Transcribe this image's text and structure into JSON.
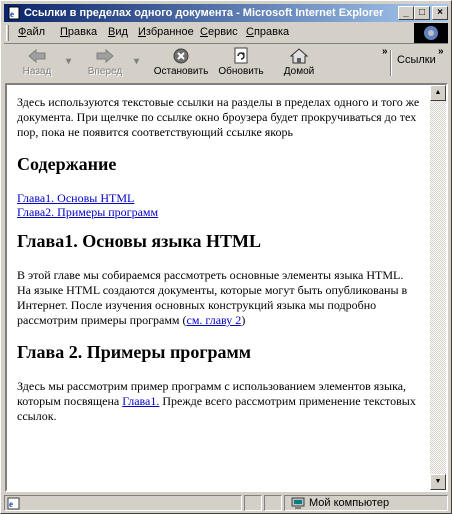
{
  "window": {
    "title": "Ссылки в пределах одного документа - Microsoft Internet Explorer"
  },
  "menu": [
    {
      "label": "Файл",
      "ul": "Ф",
      "rest": "айл"
    },
    {
      "label": "Правка",
      "ul": "П",
      "rest": "равка"
    },
    {
      "label": "Вид",
      "ul": "В",
      "rest": "ид"
    },
    {
      "label": "Избранное",
      "ul": "И",
      "rest": "збранное"
    },
    {
      "label": "Сервис",
      "ul": "С",
      "rest": "ервис"
    },
    {
      "label": "Справка",
      "ul": "С",
      "rest": "правка"
    }
  ],
  "toolbar": {
    "back": "Назад",
    "forward": "Вперед",
    "stop": "Остановить",
    "refresh": "Обновить",
    "home": "Домой",
    "links": "Ссылки",
    "chevron": "»"
  },
  "content": {
    "intro": "Здесь используются текстовые ссылки на разделы в пределах одного и того же документа. При щелчке по ссылке окно броузера будет прокручиваться до тех пор, пока не появится соответствующий ссылке якорь",
    "toc_heading": "Содержание",
    "toc_links": [
      "Глава1. Основы HTML",
      "Глава2. Примеры программ"
    ],
    "ch1_heading": "Глава1. Основы языка HTML",
    "ch1_text": "В этой главе мы собираемся рассмотреть основные элементы языка HTML. На языке HTML создаются документы, которые могут быть опубликованы в Интернет. После изучения основных конструкций языка мы подробно рассмотрим примеры программ (",
    "ch1_link": "см. главу 2",
    "ch1_after": ")",
    "ch2_heading": "Глава 2. Примеры программ",
    "ch2_text": "Здесь мы рассмотрим пример программ с использованием элементов языка, которым посвящена ",
    "ch2_link": "Глава1.",
    "ch2_after": " Прежде всего рассмотрим применение текстовых ссылок."
  },
  "status": {
    "zone": "Мой компьютер"
  }
}
